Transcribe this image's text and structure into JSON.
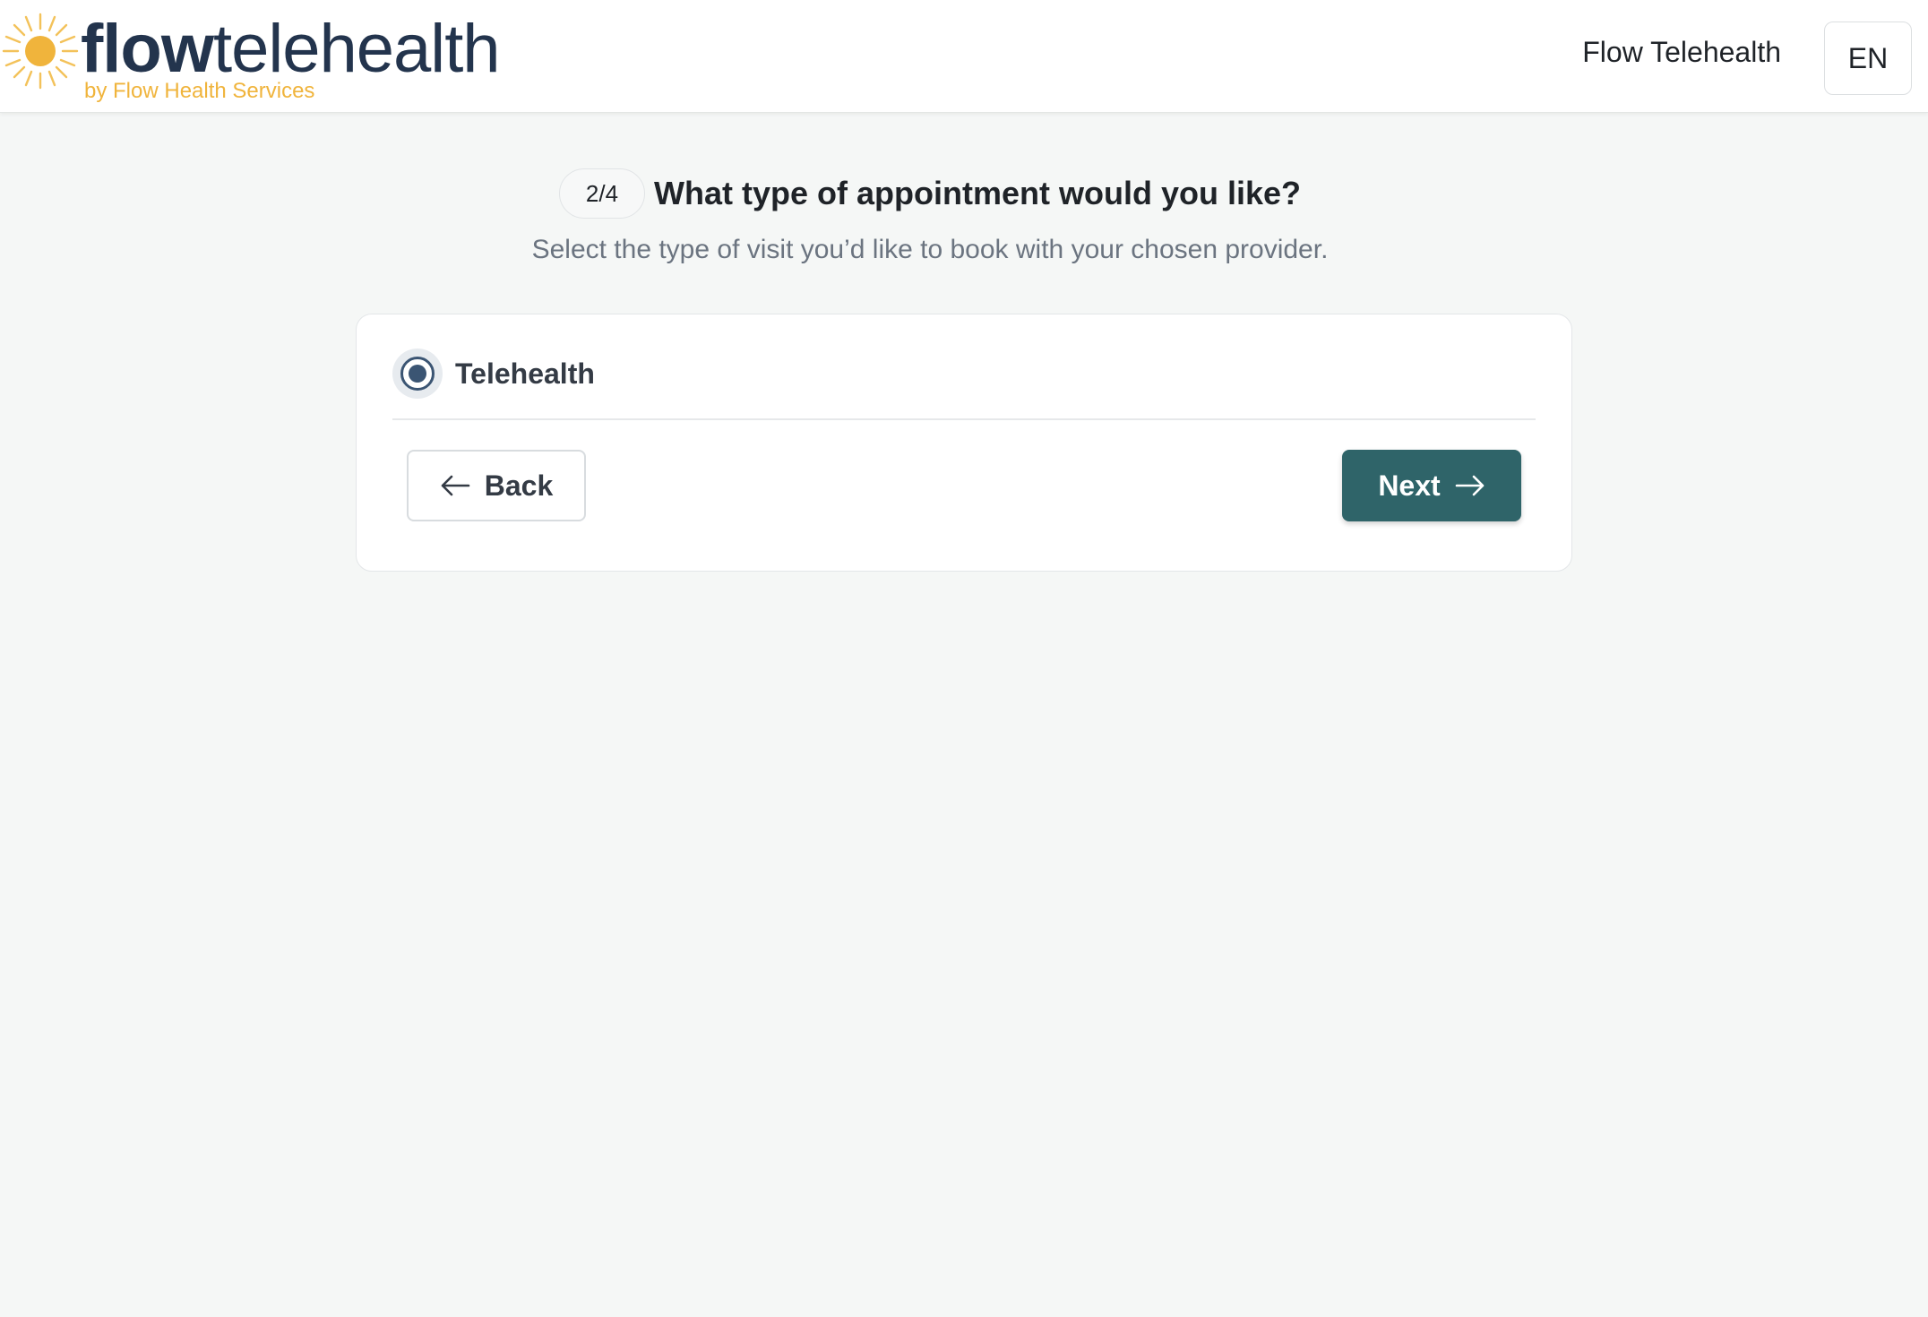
{
  "header": {
    "logo": {
      "word_bold": "flow",
      "word_light": "telehealth",
      "tagline": "by Flow Health Services",
      "sun_color": "#f0b43c",
      "text_color": "#23344d"
    },
    "nav_link": "Flow Telehealth",
    "language": "EN"
  },
  "step": {
    "badge": "2/4",
    "title": "What type of appointment would you like?",
    "subtitle": "Select the type of visit you’d like to book with your chosen provider."
  },
  "options": [
    {
      "label": "Telehealth",
      "selected": true
    }
  ],
  "actions": {
    "back_label": "Back",
    "next_label": "Next",
    "primary_color": "#2f6469"
  },
  "icons": {
    "back": "arrow-left-icon",
    "next": "arrow-right-icon",
    "logo": "sun-icon"
  }
}
